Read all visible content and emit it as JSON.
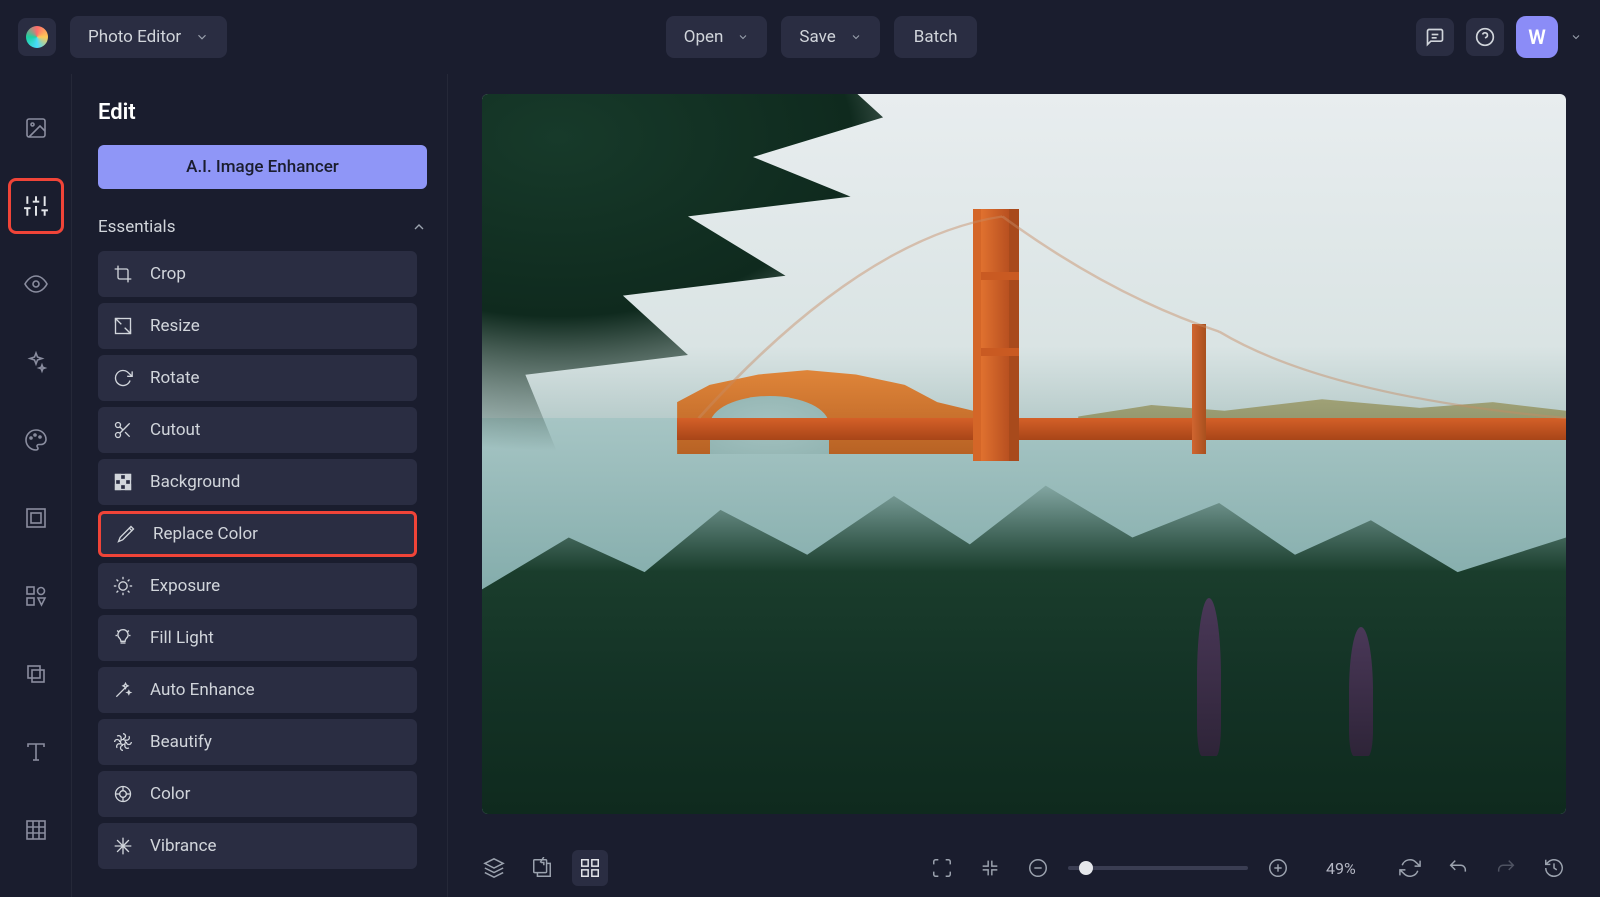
{
  "header": {
    "mode_label": "Photo Editor",
    "open_label": "Open",
    "save_label": "Save",
    "batch_label": "Batch",
    "avatar_letter": "W"
  },
  "panel": {
    "title": "Edit",
    "ai_enhancer_label": "A.I. Image Enhancer",
    "section_essentials": "Essentials",
    "tools": [
      {
        "name": "crop",
        "label": "Crop"
      },
      {
        "name": "resize",
        "label": "Resize"
      },
      {
        "name": "rotate",
        "label": "Rotate"
      },
      {
        "name": "cutout",
        "label": "Cutout"
      },
      {
        "name": "background",
        "label": "Background"
      },
      {
        "name": "replace-color",
        "label": "Replace Color",
        "highlighted": true
      },
      {
        "name": "exposure",
        "label": "Exposure"
      },
      {
        "name": "fill-light",
        "label": "Fill Light"
      },
      {
        "name": "auto-enhance",
        "label": "Auto Enhance"
      },
      {
        "name": "beautify",
        "label": "Beautify"
      },
      {
        "name": "color",
        "label": "Color"
      },
      {
        "name": "vibrance",
        "label": "Vibrance"
      }
    ]
  },
  "rail": {
    "items": [
      {
        "name": "image-tab",
        "active": false,
        "highlighted": false
      },
      {
        "name": "adjust-tab",
        "active": true,
        "highlighted": true
      },
      {
        "name": "view-tab",
        "active": false,
        "highlighted": false
      },
      {
        "name": "effects-tab",
        "active": false,
        "highlighted": false
      },
      {
        "name": "art-tab",
        "active": false,
        "highlighted": false
      },
      {
        "name": "frame-tab",
        "active": false,
        "highlighted": false
      },
      {
        "name": "elements-tab",
        "active": false,
        "highlighted": false
      },
      {
        "name": "overlay-tab",
        "active": false,
        "highlighted": false
      },
      {
        "name": "text-tab",
        "active": false,
        "highlighted": false
      },
      {
        "name": "texture-tab",
        "active": false,
        "highlighted": false
      }
    ]
  },
  "bottom": {
    "zoom_text": "49%"
  }
}
